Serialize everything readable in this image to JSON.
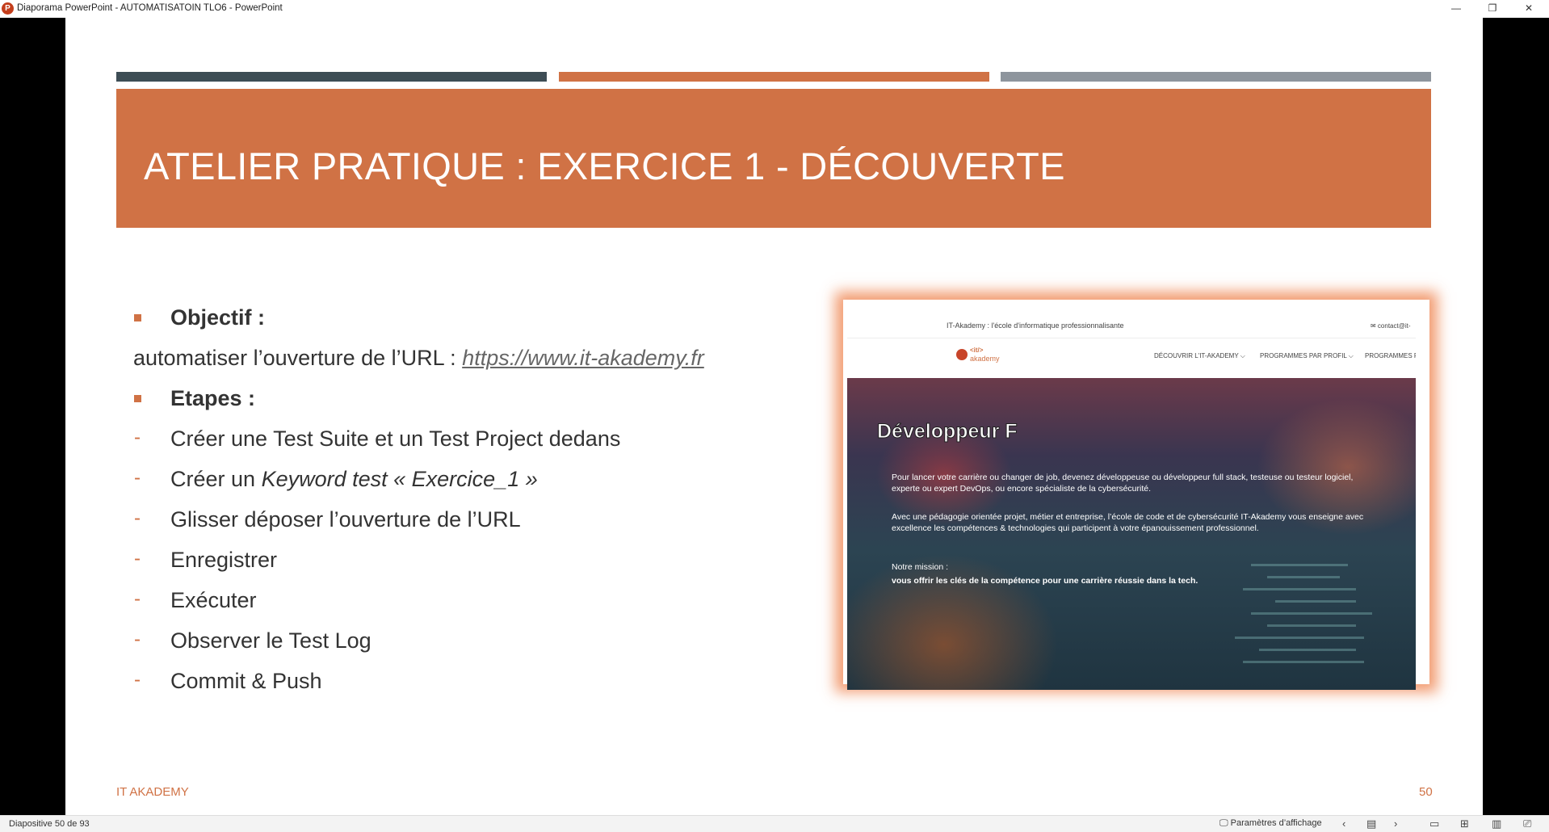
{
  "window": {
    "title": "Diaporama PowerPoint  -  AUTOMATISATOIN TLO6 - PowerPoint",
    "app_icon_letter": "P",
    "minimize": "—",
    "restore": "❐",
    "close": "✕"
  },
  "colors": {
    "accent": "#d07245",
    "bar1": "#3d4d55",
    "bar2": "#d07245",
    "bar3": "#8e959d"
  },
  "slide": {
    "title": "ATELIER PRATIQUE : EXERCICE 1 - DÉCOUVERTE",
    "objective_label": "Objectif :",
    "objective_text": "automatiser l’ouverture de l’URL : ",
    "objective_link": "https://www.it-akademy.fr",
    "steps_label": "Etapes :",
    "steps": [
      {
        "prefix": "Créer une Test Suite et un Test Project dedans"
      },
      {
        "prefix": "Créer un ",
        "italic": "Keyword test « Exercice_1 »"
      },
      {
        "prefix": "Glisser déposer l’ouverture de l’URL"
      },
      {
        "prefix": "Enregistrer"
      },
      {
        "prefix": "Exécuter"
      },
      {
        "prefix": "Observer le Test Log"
      },
      {
        "prefix": "Commit & Push"
      }
    ],
    "footer_left": "IT AKADEMY",
    "footer_right": "50"
  },
  "screenshot": {
    "top_text": "IT-Akademy : l'école d'informatique professionnalisante",
    "contact": "✉  contact@it-",
    "logo_top": "<it/>",
    "logo_bottom": "akademy",
    "nav": [
      "DÉCOUVRIR L'IT-AKADEMY ⌵",
      "PROGRAMMES PAR PROFIL ⌵",
      "PROGRAMMES P"
    ],
    "hero_title": "Développeur F",
    "hero_p1": "Pour lancer votre carrière ou changer de job, devenez développeuse ou développeur full stack, testeuse ou testeur logiciel, experte ou expert DevOps, ou encore spécialiste de la cybersécurité.",
    "hero_p2": "Avec une pédagogie orientée projet, métier et entreprise, l’école de code et de cybersécurité IT-Akademy vous enseigne avec excellence les compétences & technologies qui participent à votre épanouissement professionnel.",
    "mission_label": "Notre mission :",
    "mission_text": "vous offrir les clés de la compétence pour une carrière réussie dans la tech."
  },
  "statusbar": {
    "slide_counter": "Diapositive 50 de 93",
    "display_settings": "Paramètres d’affichage"
  }
}
